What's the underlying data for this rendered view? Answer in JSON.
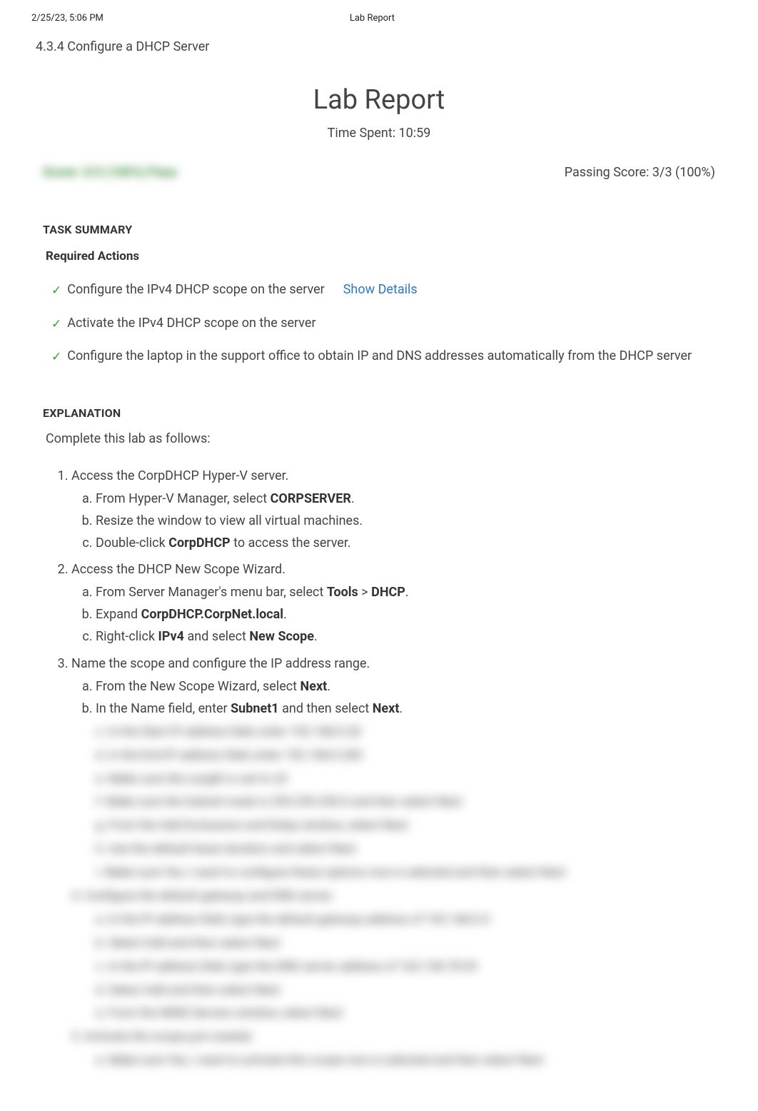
{
  "header": {
    "datetime": "2/25/23, 5:06 PM",
    "doc_title": "Lab Report"
  },
  "section": "4.3.4 Configure a DHCP Server",
  "title": "Lab Report",
  "time_spent": "Time Spent: 10:59",
  "score_blur": "Score: 3/3 (100%) Pass",
  "passing_score": "Passing Score: 3/3 (100%)",
  "task_summary_heading": "TASK SUMMARY",
  "required_actions_heading": "Required Actions",
  "actions": [
    {
      "text": "Configure the IPv4 DHCP scope on the server",
      "details": "Show Details"
    },
    {
      "text": "Activate the IPv4 DHCP scope on the server",
      "details": ""
    },
    {
      "text": "Configure the laptop in the support office to obtain IP and DNS addresses automatically from the DHCP server",
      "details": ""
    }
  ],
  "explanation_heading": "EXPLANATION",
  "explanation_intro": "Complete this lab as follows:",
  "steps": [
    {
      "text": "Access the CorpDHCP Hyper-V server.",
      "sub": [
        {
          "pre": "From Hyper-V Manager, select ",
          "bold": "CORPSERVER",
          "post": "."
        },
        {
          "pre": "Resize the window to view all virtual machines.",
          "bold": "",
          "post": ""
        },
        {
          "pre": "Double-click ",
          "bold": "CorpDHCP",
          "post": " to access the server."
        }
      ]
    },
    {
      "text": "Access the DHCP New Scope Wizard.",
      "sub": [
        {
          "pre": "From Server Manager's menu bar, select ",
          "bold": "Tools",
          "post": " > ",
          "bold2": "DHCP",
          "post2": "."
        },
        {
          "pre": "Expand ",
          "bold": "CorpDHCP.CorpNet.local",
          "post": "."
        },
        {
          "pre": "Right-click ",
          "bold": "IPv4",
          "post": " and select ",
          "bold2": "New Scope",
          "post2": "."
        }
      ]
    },
    {
      "text": "Name the scope and configure the IP address range.",
      "sub": [
        {
          "pre": "From the New Scope Wizard, select ",
          "bold": "Next",
          "post": "."
        },
        {
          "pre": "In the Name field, enter ",
          "bold": "Subnet1",
          "post": " and then select ",
          "bold2": "Next",
          "post2": "."
        }
      ]
    }
  ],
  "blur_lines": [
    "c. In the  Start IP address  field, enter  192.168.0.20",
    "d. In the  End IP address  field, enter  192.168.0.200",
    "e. Make sure the Length is set to  24",
    "f. Make sure the  Subnet mask is  255.255.255.0  and then select  Next",
    "g. From the  Add Exclusions and Delay  window, select  Next",
    "h. Use the default lease duration and select  Next",
    "i. Make sure  Yes, I want to configure these options now  is selected and then select  Next",
    "4. Configure the default gateway and DNS server.",
    "a. In the IP address field, type the default gateway address of  192.168.0.5",
    "b. Select  Add  and then select  Next",
    "c. In the IP address field, type the DNS server address of  163.128.78.93",
    "d. Select  Add  and then select  Next",
    "e. From the WINS Servers window, select  Next",
    "5. Activate the scope just created.",
    "a. Make sure  Yes, I want to activate this scope now  is selected and then select  Next"
  ]
}
